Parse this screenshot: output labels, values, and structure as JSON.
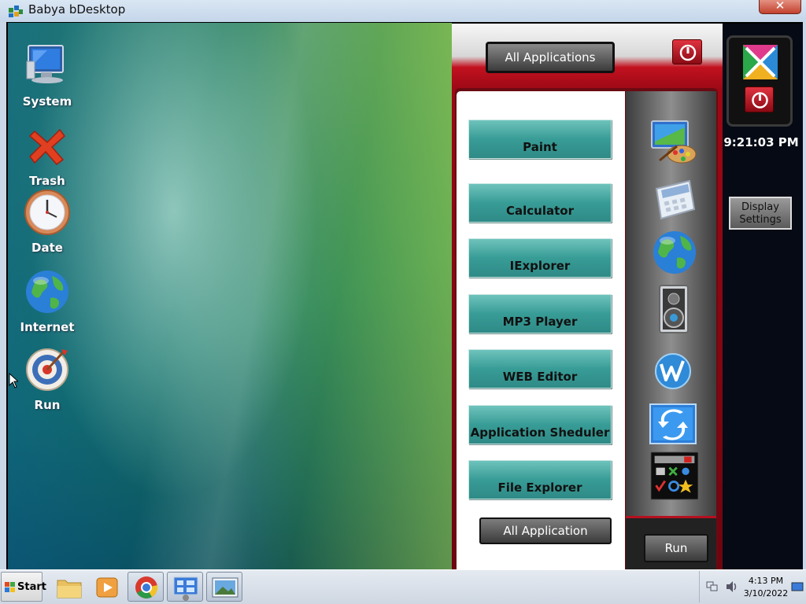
{
  "window": {
    "title": "Babya bDesktop",
    "close_label": "✕"
  },
  "desktop_icons": [
    {
      "label": "System",
      "icon": "monitor-icon"
    },
    {
      "label": "Trash",
      "icon": "trash-x-icon"
    },
    {
      "label": "Date",
      "icon": "clock-icon"
    },
    {
      "label": "Internet",
      "icon": "globe-icon"
    },
    {
      "label": "Run",
      "icon": "target-icon"
    }
  ],
  "menu": {
    "top_button": "All Applications",
    "apps": [
      {
        "label": "Paint",
        "icon": "paint-palette-icon"
      },
      {
        "label": "Calculator",
        "icon": "calculator-icon"
      },
      {
        "label": "IExplorer",
        "icon": "globe-icon"
      },
      {
        "label": "MP3 Player",
        "icon": "speaker-icon"
      },
      {
        "label": "WEB Editor",
        "icon": "web-editor-icon"
      },
      {
        "label": "Application Sheduler",
        "icon": "scheduler-icon"
      },
      {
        "label": "File Explorer",
        "icon": "file-explorer-icon"
      }
    ],
    "bottom_button": "All Application",
    "run_button": "Run"
  },
  "side": {
    "clock": "9:21:03 PM",
    "display_settings": "Display Settings"
  },
  "taskbar": {
    "start_label": "Start",
    "items": [
      "folder-icon",
      "media-player-icon",
      "chrome-icon",
      "network-app-icon",
      "picture-app-icon"
    ],
    "time": "4:13 PM",
    "date": "3/10/2022"
  },
  "colors": {
    "accent_red": "#b51020",
    "app_button_teal": "#389c96",
    "side_bar": "#050a15"
  }
}
